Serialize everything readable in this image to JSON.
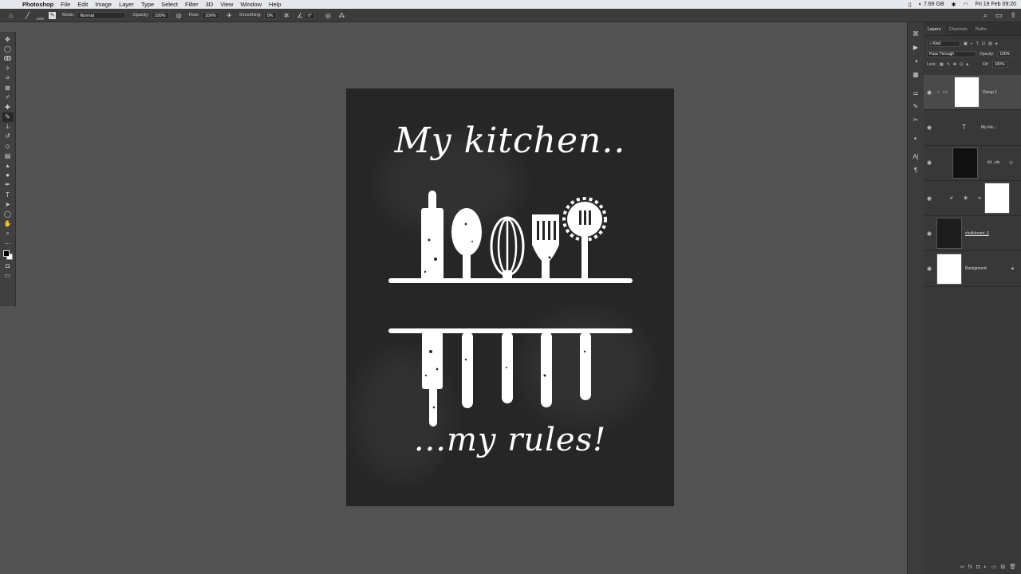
{
  "menubar": {
    "app": "Photoshop",
    "items": [
      "File",
      "Edit",
      "Image",
      "Layer",
      "Type",
      "Select",
      "Filter",
      "3D",
      "View",
      "Window",
      "Help"
    ],
    "memory": "7.69 GB",
    "datetime": "Fri 19 Feb  09:20"
  },
  "options": {
    "brush_size": "1400",
    "mode_label": "Mode:",
    "mode_value": "Normal",
    "opacity_label": "Opacity:",
    "opacity_value": "100%",
    "flow_label": "Flow:",
    "flow_value": "100%",
    "smoothing_label": "Smoothing:",
    "smoothing_value": "0%",
    "angle_value": "0°"
  },
  "canvas": {
    "headline": "My kitchen..",
    "tagline": "...my rules!",
    "background_color": "#262626",
    "text_color": "#ffffff"
  },
  "layers_panel": {
    "tabs": [
      "Layers",
      "Channels",
      "Paths"
    ],
    "filter_kind": "Kind",
    "blend_mode": "Pass Through",
    "opacity_label": "Opacity:",
    "opacity_value": "100%",
    "lock_label": "Lock:",
    "fill_label": "Fill:",
    "fill_value": "100%",
    "layers": [
      {
        "name": "Group 1",
        "kind": "group",
        "selected": true
      },
      {
        "name": "My kitc...",
        "kind": "text"
      },
      {
        "name": "kit...els",
        "kind": "smart-object"
      },
      {
        "name": "",
        "kind": "adjustment"
      },
      {
        "name": "chalkboard_6",
        "kind": "smart-object"
      },
      {
        "name": "Background",
        "kind": "background",
        "locked": true
      }
    ]
  }
}
